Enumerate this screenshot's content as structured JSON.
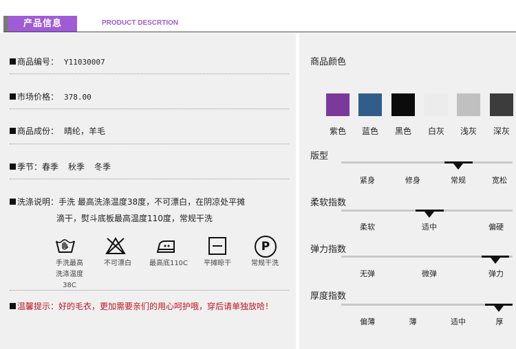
{
  "header": {
    "tab_label": "产品信息",
    "subtitle": "PRODUCT DESCRTION",
    "accent_color": "#a05bd7"
  },
  "info": {
    "code_label": "商品编号：",
    "code_value": "Y11030007",
    "price_label": "市场价格：",
    "price_value": "378.00",
    "material_label": "商品成份：",
    "material_value": "晴纶，羊毛",
    "season_label": "季节：",
    "season_values": [
      "春季",
      "秋季",
      "冬季"
    ],
    "wash_label": "洗涤说明：",
    "wash_line1": "手洗 最高洗涤温度38度，不可漂白，在阴凉处平摊",
    "wash_line2": "滴干，熨斗底板最高温度110度，常规干洗",
    "warning": "温馨提示：好的毛衣，更加需要亲们的用心呵护哦，穿后请单独放哈！"
  },
  "care_icons": [
    {
      "icon": "hand-wash-icon",
      "label": "手洗最高",
      "label2": "洗涤温度38C"
    },
    {
      "icon": "no-bleach-icon",
      "label": "不可漂白"
    },
    {
      "icon": "iron-icon",
      "label": "最高底110C"
    },
    {
      "icon": "dry-flat-icon",
      "label": "平摊晾干"
    },
    {
      "icon": "dry-clean-icon",
      "label": "常规干洗",
      "glyph": "P"
    }
  ],
  "colors": {
    "title": "商品颜色",
    "items": [
      {
        "name": "紫色",
        "hex": "#7b3a9a"
      },
      {
        "name": "蓝色",
        "hex": "#315d8a"
      },
      {
        "name": "黑色",
        "hex": "#0c0c0c"
      },
      {
        "name": "白灰",
        "hex": "#ececec"
      },
      {
        "name": "浅灰",
        "hex": "#c0c0c0"
      },
      {
        "name": "深灰",
        "hex": "#3c3c3c"
      }
    ]
  },
  "scales": [
    {
      "title": "版型",
      "labels": [
        "紧身",
        "修身",
        "常规",
        "宽松"
      ],
      "selected": 2
    },
    {
      "title": "柔软指数",
      "labels": [
        "柔软",
        "适中",
        "偏硬"
      ],
      "selected": 1
    },
    {
      "title": "弹力指数",
      "labels": [
        "无弹",
        "微弹",
        "弹力"
      ],
      "selected": 2
    },
    {
      "title": "厚度指数",
      "labels": [
        "偏薄",
        "薄",
        "适中",
        "厚"
      ],
      "selected": 3
    }
  ]
}
